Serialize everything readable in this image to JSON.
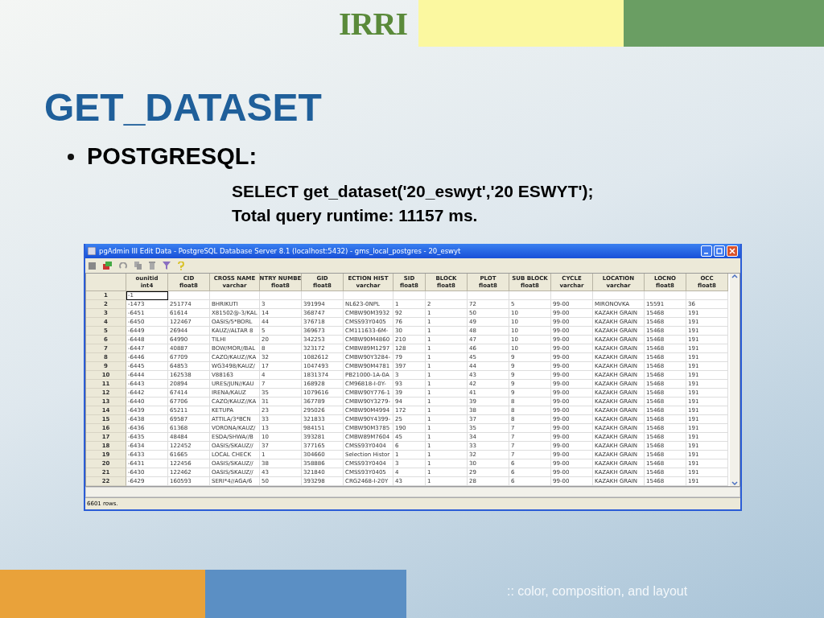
{
  "slide": {
    "logo": "IRRI",
    "title": "GET_DATASET",
    "bullet": "POSTGRESQL:",
    "query_lines": [
      "SELECT get_dataset('20_eswyt','20 ESWYT');",
      "Total query runtime: 11157 ms."
    ],
    "footer": ":: color, composition, and layout"
  },
  "window": {
    "title": "pgAdmin III Edit Data - PostgreSQL Database Server 8.1 (localhost:5432) - gms_local_postgres - 20_eswyt"
  },
  "table": {
    "columns": [
      {
        "name": "ounitid",
        "type": "int4"
      },
      {
        "name": "CID",
        "type": "float8"
      },
      {
        "name": "CROSS NAME",
        "type": "varchar"
      },
      {
        "name": "NTRY NUMBE",
        "type": "float8"
      },
      {
        "name": "GID",
        "type": "float8"
      },
      {
        "name": "ECTION HIST",
        "type": "varchar"
      },
      {
        "name": "SID",
        "type": "float8"
      },
      {
        "name": "BLOCK",
        "type": "float8"
      },
      {
        "name": "PLOT",
        "type": "float8"
      },
      {
        "name": "SUB BLOCK",
        "type": "float8"
      },
      {
        "name": "CYCLE",
        "type": "varchar"
      },
      {
        "name": "LOCATION",
        "type": "varchar"
      },
      {
        "name": "LOCNO",
        "type": "float8"
      },
      {
        "name": "OCC",
        "type": "float8"
      }
    ],
    "rows": [
      {
        "number": "1",
        "editing": true,
        "cells": [
          "-1"
        ]
      },
      {
        "number": "2",
        "editing": false,
        "cells": [
          "-1473",
          "251774",
          "BHRIKUTI",
          "3",
          "391994",
          "NL623-0NPL",
          "1",
          "2",
          "72",
          "5",
          "99-00",
          "MIRONOVKA",
          "15591",
          "36"
        ]
      },
      {
        "number": "3",
        "editing": false,
        "cells": [
          "-6451",
          "61614",
          "X81502@-3/KAL",
          "14",
          "368747",
          "CMBW90M3932",
          "92",
          "1",
          "50",
          "10",
          "99-00",
          "KAZAKH GRAIN",
          "15468",
          "191"
        ]
      },
      {
        "number": "4",
        "editing": false,
        "cells": [
          "-6450",
          "122467",
          "OASIS/5*BORL",
          "44",
          "376718",
          "CMSS93Y0405",
          "76",
          "1",
          "49",
          "10",
          "99-00",
          "KAZAKH GRAIN",
          "15468",
          "191"
        ]
      },
      {
        "number": "5",
        "editing": false,
        "cells": [
          "-6449",
          "26944",
          "KAUZ//ALTAR 8",
          "5",
          "369673",
          "CM111633-6M-",
          "30",
          "1",
          "48",
          "10",
          "99-00",
          "KAZAKH GRAIN",
          "15468",
          "191"
        ]
      },
      {
        "number": "6",
        "editing": false,
        "cells": [
          "-6448",
          "64990",
          "TILHI",
          "20",
          "342253",
          "CMBW90M4860",
          "210",
          "1",
          "47",
          "10",
          "99-00",
          "KAZAKH GRAIN",
          "15468",
          "191"
        ]
      },
      {
        "number": "7",
        "editing": false,
        "cells": [
          "-6447",
          "40887",
          "BOW/MOR//BAL",
          "8",
          "323172",
          "CMBW89M1297",
          "128",
          "1",
          "46",
          "10",
          "99-00",
          "KAZAKH GRAIN",
          "15468",
          "191"
        ]
      },
      {
        "number": "8",
        "editing": false,
        "cells": [
          "-6446",
          "67709",
          "CAZO/KAUZ//KA",
          "32",
          "1082612",
          "CMBW90Y3284-",
          "79",
          "1",
          "45",
          "9",
          "99-00",
          "KAZAKH GRAIN",
          "15468",
          "191"
        ]
      },
      {
        "number": "9",
        "editing": false,
        "cells": [
          "-6445",
          "64853",
          "WG3498/KAUZ/",
          "17",
          "1047493",
          "CMBW90M4781",
          "397",
          "1",
          "44",
          "9",
          "99-00",
          "KAZAKH GRAIN",
          "15468",
          "191"
        ]
      },
      {
        "number": "10",
        "editing": false,
        "cells": [
          "-6444",
          "162538",
          "V88163",
          "4",
          "1831374",
          "PB21000-1A-0A",
          "3",
          "1",
          "43",
          "9",
          "99-00",
          "KAZAKH GRAIN",
          "15468",
          "191"
        ]
      },
      {
        "number": "11",
        "editing": false,
        "cells": [
          "-6443",
          "20894",
          "URES/JUN//KAU",
          "7",
          "168928",
          "CM96818-I-0Y-",
          "93",
          "1",
          "42",
          "9",
          "99-00",
          "KAZAKH GRAIN",
          "15468",
          "191"
        ]
      },
      {
        "number": "12",
        "editing": false,
        "cells": [
          "-6442",
          "67414",
          "IRENA/KAUZ",
          "35",
          "1079616",
          "CMBW90Y776-1",
          "39",
          "1",
          "41",
          "9",
          "99-00",
          "KAZAKH GRAIN",
          "15468",
          "191"
        ]
      },
      {
        "number": "13",
        "editing": false,
        "cells": [
          "-6440",
          "67706",
          "CAZO/KAUZ//KA",
          "31",
          "367789",
          "CMBW90Y3279-",
          "94",
          "1",
          "39",
          "8",
          "99-00",
          "KAZAKH GRAIN",
          "15468",
          "191"
        ]
      },
      {
        "number": "14",
        "editing": false,
        "cells": [
          "-6439",
          "65211",
          "KETUPA",
          "23",
          "295026",
          "CMBW90M4994",
          "172",
          "1",
          "38",
          "8",
          "99-00",
          "KAZAKH GRAIN",
          "15468",
          "191"
        ]
      },
      {
        "number": "15",
        "editing": false,
        "cells": [
          "-6438",
          "69587",
          "ATTILA/3*BCN",
          "33",
          "321833",
          "CMBW90Y4399-",
          "25",
          "1",
          "37",
          "8",
          "99-00",
          "KAZAKH GRAIN",
          "15468",
          "191"
        ]
      },
      {
        "number": "16",
        "editing": false,
        "cells": [
          "-6436",
          "61368",
          "VORONA/KAUZ/",
          "13",
          "984151",
          "CMBW90M3785",
          "190",
          "1",
          "35",
          "7",
          "99-00",
          "KAZAKH GRAIN",
          "15468",
          "191"
        ]
      },
      {
        "number": "17",
        "editing": false,
        "cells": [
          "-6435",
          "48484",
          "ESDA/SHWA//B",
          "10",
          "393281",
          "CMBW89M7604",
          "45",
          "1",
          "34",
          "7",
          "99-00",
          "KAZAKH GRAIN",
          "15468",
          "191"
        ]
      },
      {
        "number": "18",
        "editing": false,
        "cells": [
          "-6434",
          "122452",
          "OASIS/SKAUZ//",
          "37",
          "377165",
          "CMSS93Y0404",
          "6",
          "1",
          "33",
          "7",
          "99-00",
          "KAZAKH GRAIN",
          "15468",
          "191"
        ]
      },
      {
        "number": "19",
        "editing": false,
        "cells": [
          "-6433",
          "61665",
          "LOCAL CHECK",
          "1",
          "304660",
          "Selection Histor",
          "1",
          "1",
          "32",
          "7",
          "99-00",
          "KAZAKH GRAIN",
          "15468",
          "191"
        ]
      },
      {
        "number": "20",
        "editing": false,
        "cells": [
          "-6431",
          "122456",
          "OASIS/SKAUZ//",
          "38",
          "358886",
          "CMSS93Y0404",
          "3",
          "1",
          "30",
          "6",
          "99-00",
          "KAZAKH GRAIN",
          "15468",
          "191"
        ]
      },
      {
        "number": "21",
        "editing": false,
        "cells": [
          "-6430",
          "122462",
          "OASIS/SKAUZ//",
          "43",
          "321840",
          "CMSS93Y0405",
          "4",
          "1",
          "29",
          "6",
          "99-00",
          "KAZAKH GRAIN",
          "15468",
          "191"
        ]
      },
      {
        "number": "22",
        "editing": false,
        "cells": [
          "-6429",
          "160593",
          "SERI*4//AGA/6",
          "50",
          "393298",
          "CRG2468-I-20Y",
          "43",
          "1",
          "28",
          "6",
          "99-00",
          "KAZAKH GRAIN",
          "15468",
          "191"
        ]
      }
    ]
  },
  "status_bar": "6601 rows."
}
